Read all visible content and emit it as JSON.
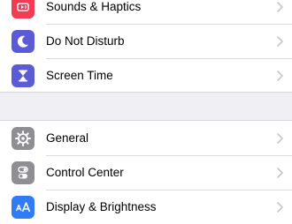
{
  "settings": {
    "group1": [
      {
        "label": "Sounds & Haptics",
        "icon": "speaker-icon",
        "icon_color": "#f33c51"
      },
      {
        "label": "Do Not Disturb",
        "icon": "moon-icon",
        "icon_color": "#5b5bd6"
      },
      {
        "label": "Screen Time",
        "icon": "hourglass-icon",
        "icon_color": "#5b5bd6"
      }
    ],
    "group2": [
      {
        "label": "General",
        "icon": "gear-icon",
        "icon_color": "#8e8e93"
      },
      {
        "label": "Control Center",
        "icon": "toggles-icon",
        "icon_color": "#8e8e93"
      },
      {
        "label": "Display & Brightness",
        "icon": "text-size-icon",
        "icon_color": "#2f7cf6"
      }
    ]
  },
  "colors": {
    "background": "#efeff4",
    "chevron": "#c7c7cc",
    "separator": "#dcdce0"
  }
}
